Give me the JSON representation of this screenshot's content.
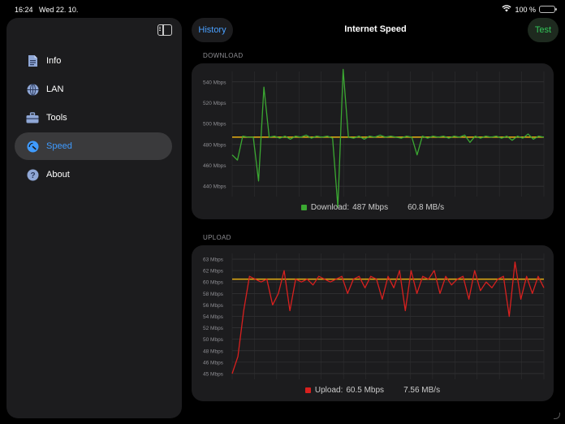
{
  "status_bar": {
    "time": "16:24",
    "date": "Wed 22. 10.",
    "battery": "100 %",
    "battery_level": 1.0
  },
  "sidebar": {
    "items": [
      {
        "label": "Info",
        "icon": "doc-icon",
        "active": false
      },
      {
        "label": "LAN",
        "icon": "globe-icon",
        "active": false
      },
      {
        "label": "Tools",
        "icon": "toolbox-icon",
        "active": false
      },
      {
        "label": "Speed",
        "icon": "speedometer-icon",
        "active": true
      },
      {
        "label": "About",
        "icon": "question-circle-icon",
        "active": false
      }
    ]
  },
  "header": {
    "history_label": "History",
    "title": "Internet Speed",
    "test_label": "Test"
  },
  "colors": {
    "accent": "#3f9bff",
    "download": "#3ba832",
    "upload": "#d8201e",
    "average": "#d9a514",
    "test": "#33c75a"
  },
  "download": {
    "section_label": "DOWNLOAD",
    "legend_prefix": "Download:",
    "legend_value": "487 Mbps",
    "legend_bytes": "60.8 MB/s",
    "y_ticks": [
      "540 Mbps",
      "520 Mbps",
      "500 Mbps",
      "480 Mbps",
      "460 Mbps",
      "440 Mbps"
    ],
    "y_tick_values": [
      540,
      520,
      500,
      480,
      460,
      440
    ],
    "ylim": [
      430,
      550
    ],
    "average": 487,
    "values": [
      470,
      465,
      488,
      487,
      487,
      445,
      535,
      487,
      488,
      486,
      488,
      485,
      488,
      487,
      489,
      486,
      488,
      487,
      488,
      486,
      420,
      552,
      487,
      486,
      488,
      485,
      488,
      487,
      489,
      487,
      488,
      487,
      486,
      488,
      487,
      470,
      488,
      486,
      488,
      487,
      488,
      486,
      488,
      487,
      489,
      482,
      488,
      486,
      488,
      487,
      488,
      486,
      488,
      484,
      488,
      486,
      490,
      485,
      488,
      487
    ]
  },
  "upload": {
    "section_label": "UPLOAD",
    "legend_prefix": "Upload:",
    "legend_value": "60.5 Mbps",
    "legend_bytes": "7.56 MB/s",
    "y_ticks": [
      "63 Mbps",
      "62 Mbps",
      "60 Mbps",
      "58 Mbps",
      "56 Mbps",
      "54 Mbps",
      "52 Mbps",
      "50 Mbps",
      "48 Mbps",
      "46 Mbps",
      "45 Mbps"
    ],
    "y_tick_values": [
      64,
      62,
      60,
      58,
      56,
      54,
      52,
      50,
      48,
      46,
      44
    ],
    "ylim": [
      43,
      65
    ],
    "average": 60.5,
    "values": [
      44,
      47,
      55,
      61,
      60.5,
      60,
      60.5,
      56,
      58,
      62,
      55,
      60.5,
      60,
      60.5,
      59.5,
      61,
      60.5,
      60,
      60.5,
      61,
      58,
      60.5,
      61,
      59,
      61,
      60.5,
      57,
      61,
      59,
      62,
      55,
      62,
      58,
      61,
      60.5,
      62,
      58,
      61,
      59.5,
      60.5,
      61,
      57,
      62,
      58.5,
      60,
      59,
      60.5,
      61,
      54,
      63.5,
      57,
      61,
      58,
      61,
      59
    ]
  }
}
